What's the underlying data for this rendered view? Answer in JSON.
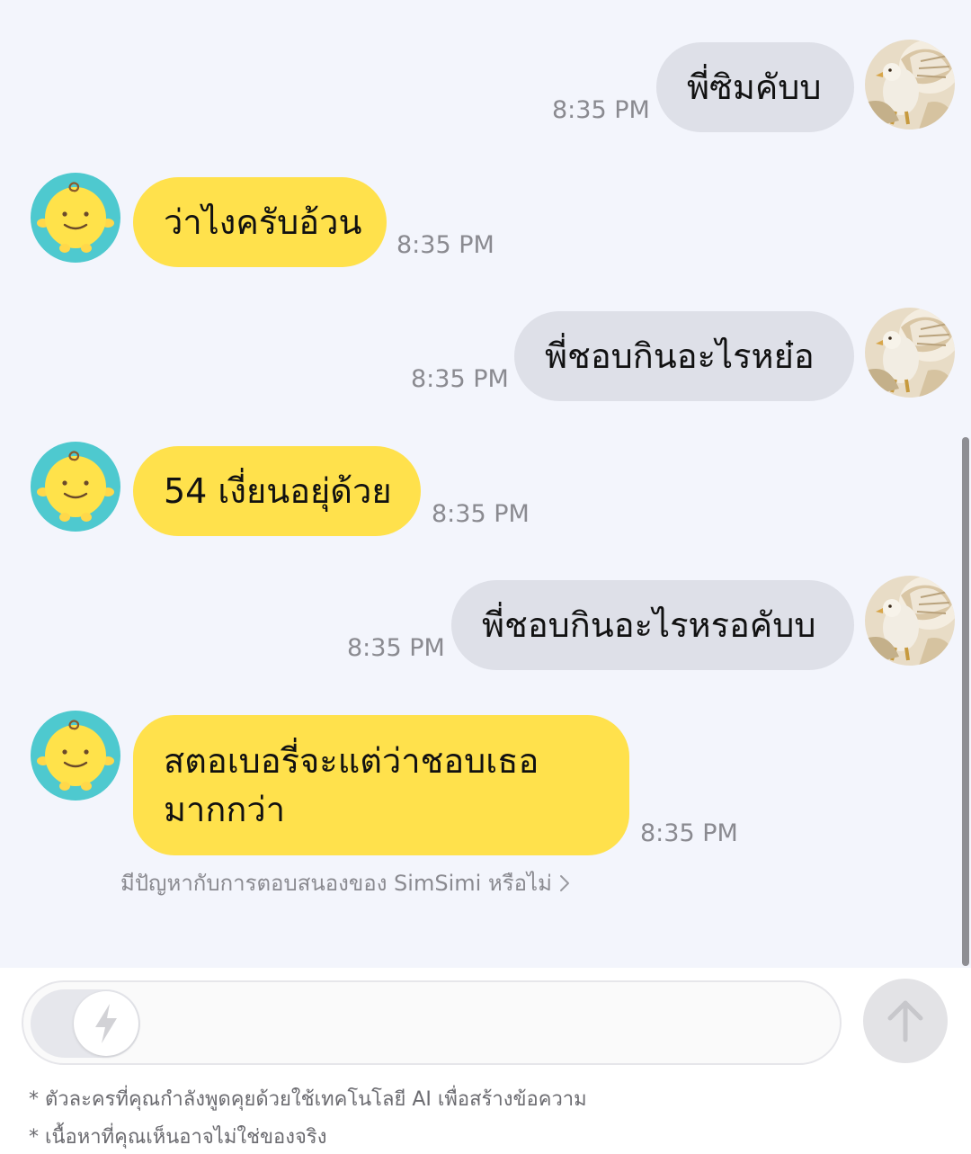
{
  "messages": [
    {
      "sender": "user",
      "text": "พี่ซิมคับบ",
      "time": "8:35 PM"
    },
    {
      "sender": "bot",
      "text": "ว่าไงครับอ้วน",
      "time": "8:35 PM"
    },
    {
      "sender": "user",
      "text": "พี่ชอบกินอะไรหย๋อ",
      "time": "8:35 PM"
    },
    {
      "sender": "bot",
      "text": "54 เงี่ยนอยุ่ด้วย",
      "time": "8:35 PM"
    },
    {
      "sender": "user",
      "text": "พี่ชอบกินอะไรหรอคับบ",
      "time": "8:35 PM"
    },
    {
      "sender": "bot",
      "text": "สตอเบอรี่จะแต่ว่าชอบเธอมากกว่า",
      "text_lines": [
        "สตอเบอรี่จะแต่ว่าชอบเธอ",
        "มากกว่า"
      ],
      "time": "8:35 PM"
    }
  ],
  "report_link": "มีปัญหากับการตอบสนองของ SimSimi หรือไม่",
  "input": {
    "placeholder": ""
  },
  "disclaimers": [
    "* ตัวละครที่คุณกำลังพูดคุยด้วยใช้เทคโนโลยี AI เพื่อสร้างข้อความ",
    "* เนื้อหาที่คุณเห็นอาจไม่ใช่ของจริง"
  ],
  "icons": {
    "user_avatar": "eagle-avatar",
    "bot_avatar": "simsimi-avatar",
    "toggle": "lightning-icon",
    "send": "arrow-up-icon",
    "report": "chevron-right-icon"
  },
  "colors": {
    "background": "#f3f5fc",
    "user_bubble": "#dee0e8",
    "bot_bubble": "#ffe14c",
    "bot_avatar_ring": "#4ec9cf",
    "bot_face": "#ffe24a",
    "send_button": "#e3e3e6"
  }
}
